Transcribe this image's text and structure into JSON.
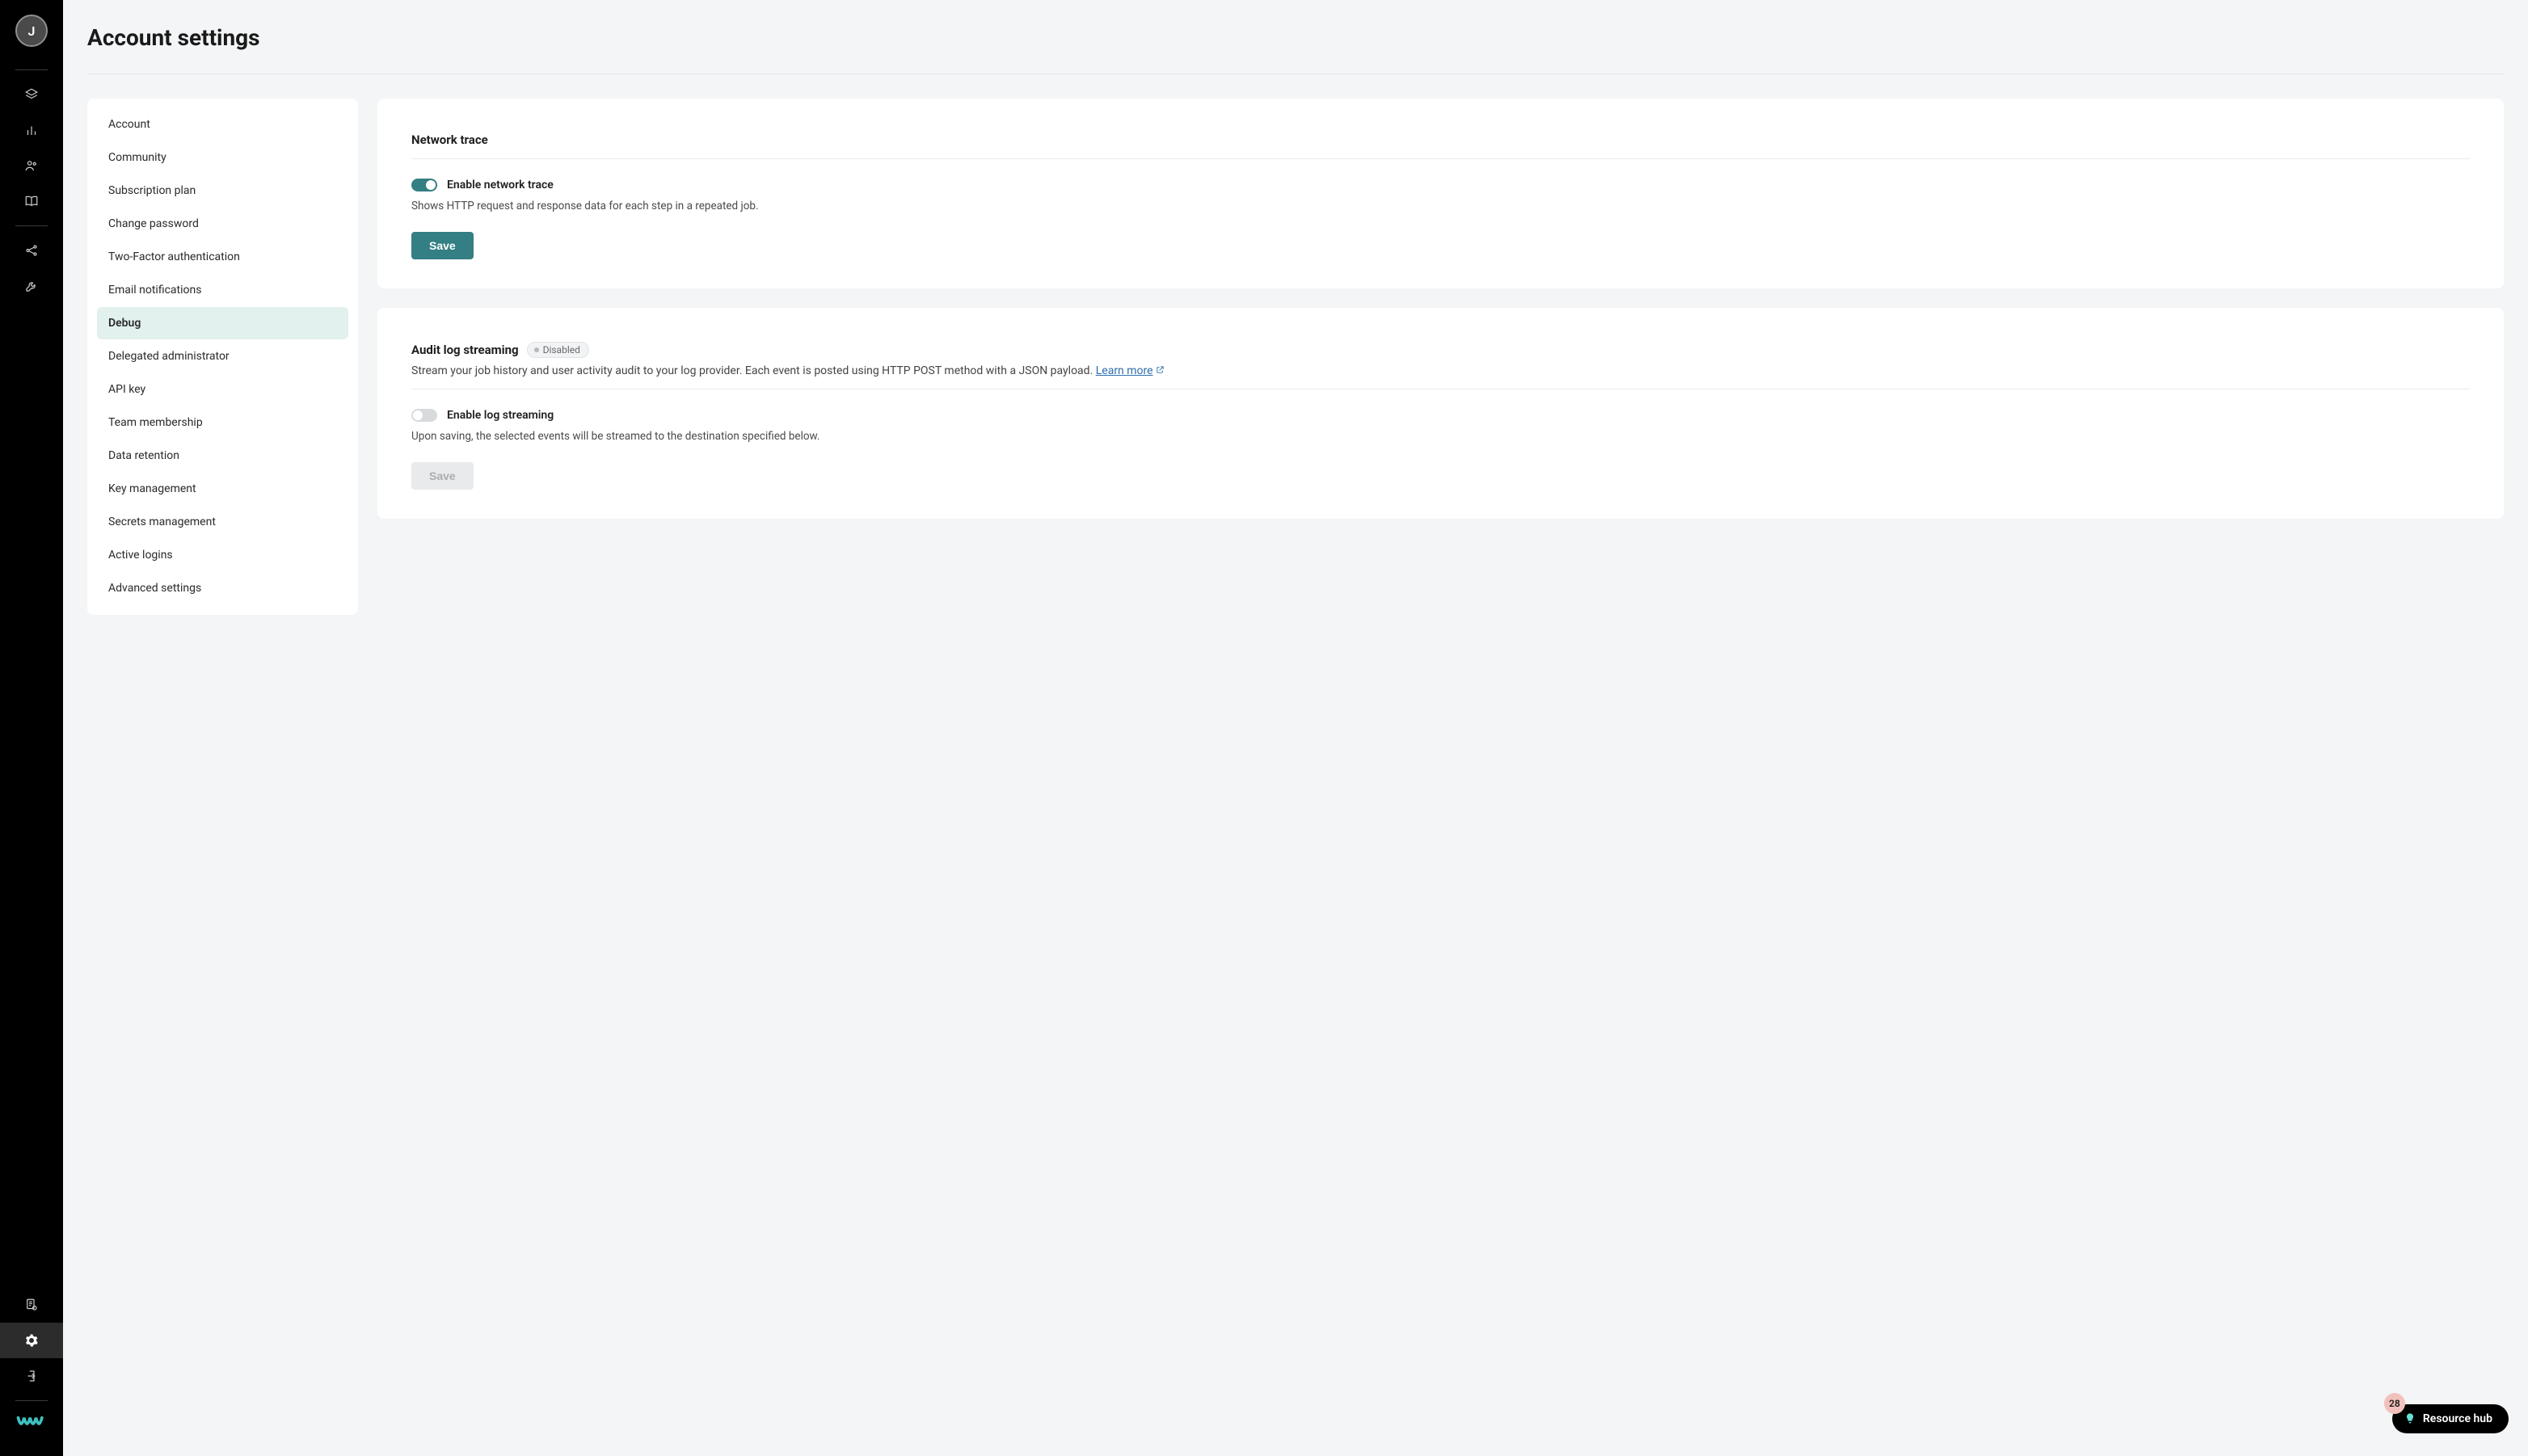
{
  "avatar_initial": "J",
  "page_title": "Account settings",
  "settings_nav": [
    "Account",
    "Community",
    "Subscription plan",
    "Change password",
    "Two-Factor authentication",
    "Email notifications",
    "Debug",
    "Delegated administrator",
    "API key",
    "Team membership",
    "Data retention",
    "Key management",
    "Secrets management",
    "Active logins",
    "Advanced settings"
  ],
  "settings_nav_active": "Debug",
  "network_trace": {
    "title": "Network trace",
    "toggle_label": "Enable network trace",
    "toggle_on": true,
    "description": "Shows HTTP request and response data for each step in a repeated job.",
    "save_label": "Save",
    "save_enabled": true
  },
  "audit_log": {
    "title": "Audit log streaming",
    "status_badge": "Disabled",
    "subtext": "Stream your job history and user activity audit to your log provider. Each event is posted using HTTP POST method with a JSON payload. ",
    "learn_more": "Learn more",
    "toggle_label": "Enable log streaming",
    "toggle_on": false,
    "description": "Upon saving, the selected events will be streamed to the destination specified below.",
    "save_label": "Save",
    "save_enabled": false
  },
  "resource_hub": {
    "label": "Resource hub",
    "badge_count": "28"
  }
}
